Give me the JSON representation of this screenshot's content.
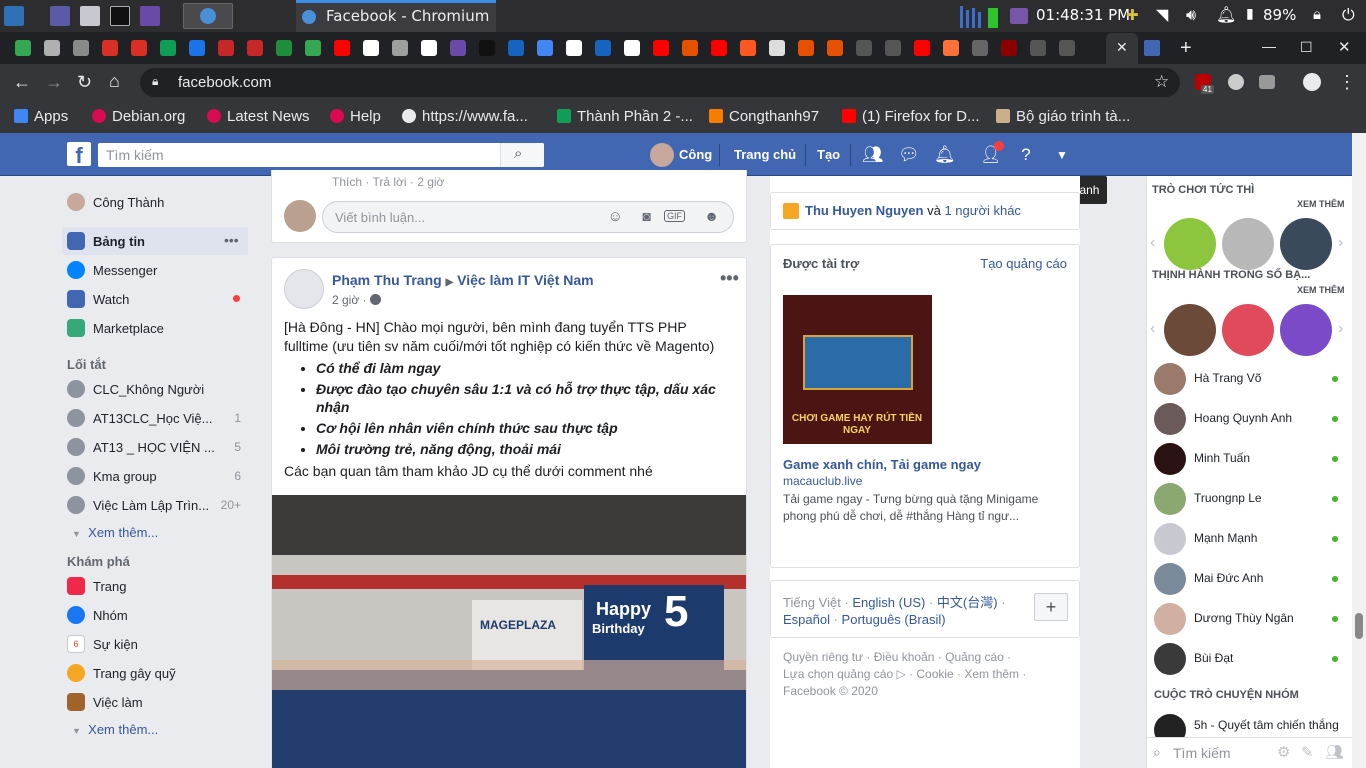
{
  "system": {
    "window_title": "Facebook - Chromium",
    "time": "01:48:31 PM",
    "battery": "89%"
  },
  "toolbar": {
    "url": "facebook.com",
    "ext_badge": "41"
  },
  "bookmarks": [
    {
      "label": "Apps"
    },
    {
      "label": "Debian.org"
    },
    {
      "label": "Latest News"
    },
    {
      "label": "Help"
    },
    {
      "label": "https://www.fa..."
    },
    {
      "label": "Thành Phần 2 -..."
    },
    {
      "label": "Congthanh97"
    },
    {
      "label": "(1) Firefox for D..."
    },
    {
      "label": "Bộ giáo trình tà..."
    }
  ],
  "header": {
    "search_placeholder": "Tìm kiếm",
    "profile": "Công",
    "home": "Trang chủ",
    "create": "Tạo",
    "tooltip": "Trợ giúp nhanh"
  },
  "left": {
    "user": "Công Thành",
    "nav": [
      {
        "label": "Bảng tin"
      },
      {
        "label": "Messenger"
      },
      {
        "label": "Watch"
      },
      {
        "label": "Marketplace"
      }
    ],
    "shortcuts_title": "Lối tắt",
    "shortcuts": [
      {
        "label": "CLC_Không Người",
        "count": ""
      },
      {
        "label": "AT13CLC_Học Việ...",
        "count": "1"
      },
      {
        "label": "AT13 _ HỌC VIỆN ...",
        "count": "5"
      },
      {
        "label": "Kma group",
        "count": "6"
      },
      {
        "label": "Việc Làm Lập Trìn...",
        "count": "20+"
      }
    ],
    "more1": "Xem thêm...",
    "explore_title": "Khám phá",
    "explore": [
      {
        "label": "Trang"
      },
      {
        "label": "Nhóm"
      },
      {
        "label": "Sự kiện"
      },
      {
        "label": "Trang gây quỹ"
      },
      {
        "label": "Việc làm"
      }
    ],
    "more2": "Xem thêm..."
  },
  "feed": {
    "top_actions": "Thích · Trả lời · 2 giờ",
    "comment_placeholder": "Viết bình luận...",
    "post": {
      "author": "Phạm Thu Trang",
      "group": "Việc làm IT Việt Nam",
      "time": "2 giờ ·",
      "intro": "[Hà Đông - HN] Chào mọi người, bên mình đang tuyển TTS PHP fulltime (ưu tiên sv năm cuối/mới tốt nghiệp có kiến thức về Magento)",
      "bullets": [
        "Có thể đi làm ngay",
        "Được đào tạo chuyên sâu 1:1 và có hỗ trợ thực tập, dấu xác nhận",
        "Cơ hội lên nhân viên chính thức sau thực tập",
        "Môi trường trẻ, năng động, thoải mái"
      ],
      "outro": "Các bạn quan tâm tham khảo JD cụ thể dưới comment nhé",
      "photo_text": {
        "brand": "MAGEPLAZA",
        "banner1": "Happy",
        "banner2": "Birthday",
        "number": "5"
      }
    }
  },
  "right": {
    "birthday_name": "Thu Huyen Nguyen",
    "birthday_and": "và",
    "birthday_others": "1 người khác",
    "sponsored": "Được tài trợ",
    "create_ad": "Tạo quảng cáo",
    "ad_image_text": "CHƠI GAME HAY RÚT TIỀN NGAY",
    "ad_title": "Game xanh chín, Tải game ngay",
    "ad_domain": "macauclub.live",
    "ad_desc": "Tải game ngay - Tưng bừng quà tặng  Minigame phong phú dễ chơi, dễ #thắng  Hàng tỉ ngư...",
    "lang_current": "Tiếng Việt ·",
    "lang_en": "English (US)",
    "lang_zh": "中文(台灣)",
    "lang_es": "Español",
    "lang_pt": "Português (Brasil)",
    "footer1": "Quyền riêng tư · Điều khoản · Quảng cáo ·",
    "footer2": "Lựa chọn quảng cáo ▷ · Cookie · Xem thêm ·",
    "footer3": "Facebook © 2020"
  },
  "chat": {
    "games_title": "TRÒ CHƠI TỨC THÌ",
    "see_more": "XEM THÊM",
    "trending_title": "THỊNH HÀNH TRONG SỐ BẠ...",
    "see_more2": "XEM THÊM",
    "contacts": [
      {
        "name": "Hà Trang Võ"
      },
      {
        "name": "Hoang Quynh Anh"
      },
      {
        "name": "Minh Tuấn"
      },
      {
        "name": "Truongnp Le"
      },
      {
        "name": "Mạnh Mạnh"
      },
      {
        "name": "Mai Đức Anh"
      },
      {
        "name": "Dương Thùy Ngân"
      },
      {
        "name": "Bùi Đạt"
      }
    ],
    "group_title": "CUỘC TRÒ CHUYỆN NHÓM",
    "group_item": "5h - Quyết tâm chiến thắng",
    "search_placeholder": "Tìm kiếm"
  }
}
